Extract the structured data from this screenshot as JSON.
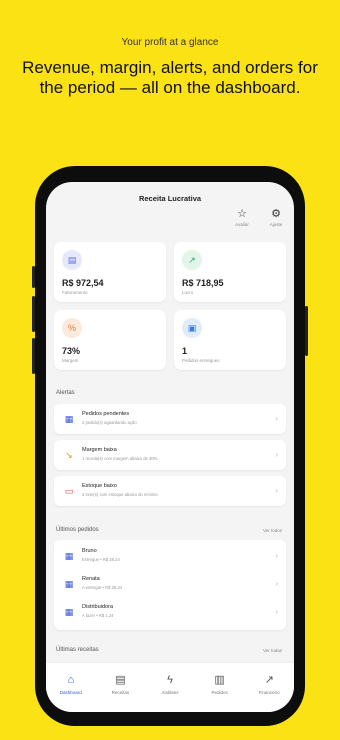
{
  "marketing": {
    "tagline": "Your profit at a glance",
    "headline": "Revenue, margin, alerts, and orders for the period — all on the dashboard."
  },
  "app": {
    "title": "Receita Lucrativa",
    "header_buttons": [
      {
        "icon": "star-icon",
        "glyph": "☆",
        "label": "Avaliar"
      },
      {
        "icon": "gear-icon",
        "glyph": "⚙",
        "label": "Ajuste"
      }
    ]
  },
  "kpis": [
    {
      "icon": "revenue-icon",
      "glyph": "▤",
      "color": "#5b6fe0",
      "bg": "#e6e9fb",
      "value": "R$ 972,54",
      "label": "Faturamento"
    },
    {
      "icon": "profit-trend-icon",
      "glyph": "↗",
      "color": "#2fa86a",
      "bg": "#e2f5ea",
      "value": "R$ 718,95",
      "label": "Lucro"
    },
    {
      "icon": "percent-icon",
      "glyph": "%",
      "color": "#e07b3a",
      "bg": "#fcebdd",
      "value": "73%",
      "label": "Margem"
    },
    {
      "icon": "delivered-orders-icon",
      "glyph": "▣",
      "color": "#3a7be0",
      "bg": "#e1ecfb",
      "value": "1",
      "label": "Pedidos entregues"
    }
  ],
  "alerts": {
    "title": "Alertas",
    "items": [
      {
        "icon": "pending-orders-icon",
        "glyph": "▦",
        "color": "#3a55d8",
        "title": "Pedidos pendentes",
        "subtitle": "2 pedido(s) aguardando ação"
      },
      {
        "icon": "low-margin-icon",
        "glyph": "↘",
        "color": "#e0962a",
        "title": "Margem baixa",
        "subtitle": "1 receita(s) com margem abaixo de 30%"
      },
      {
        "icon": "low-stock-icon",
        "glyph": "▭",
        "color": "#e0463a",
        "title": "Estoque baixo",
        "subtitle": "3 item(s) com estoque abaixo do mínimo"
      }
    ]
  },
  "orders": {
    "title": "Últimos pedidos",
    "see_all": "Ver todos",
    "items": [
      {
        "icon": "order-icon",
        "glyph": "▦",
        "title": "Bruno",
        "subtitle": "Entregue • R$ 28,24"
      },
      {
        "icon": "order-icon",
        "glyph": "▦",
        "title": "Renata",
        "subtitle": "A entregar • R$ 28,24"
      },
      {
        "icon": "order-icon",
        "glyph": "▦",
        "title": "Distribuidora",
        "subtitle": "A fazer • R$ 1,24"
      }
    ]
  },
  "recipes": {
    "title": "Últimas receitas",
    "see_all": "Ver todas"
  },
  "nav": [
    {
      "icon": "home-icon",
      "glyph": "⌂",
      "label": "Dashboard",
      "active": true
    },
    {
      "icon": "recipes-icon",
      "glyph": "▤",
      "label": "Receitas",
      "active": false
    },
    {
      "icon": "analysis-icon",
      "glyph": "ϟ",
      "label": "Análises",
      "active": false
    },
    {
      "icon": "orders-icon",
      "glyph": "▥",
      "label": "Pedidos",
      "active": false
    },
    {
      "icon": "finance-icon",
      "glyph": "↗",
      "label": "Financeiro",
      "active": false
    }
  ],
  "chevron": "›"
}
